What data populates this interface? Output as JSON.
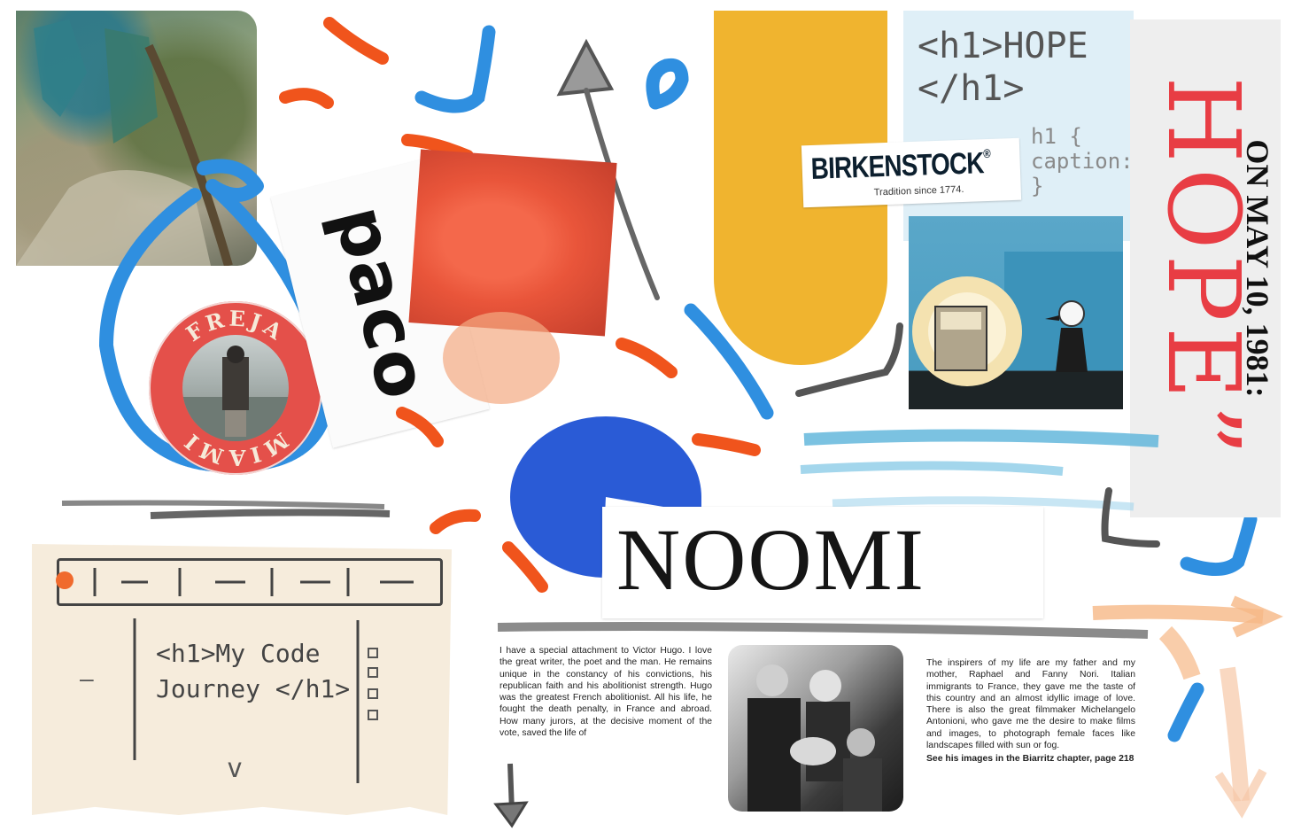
{
  "collage": {
    "paco": "paco",
    "freja_top": "FREJA",
    "freja_bottom": "MIAMI",
    "birkenstock": "BIRKENSTOCK",
    "birkenstock_reg": "®",
    "birkenstock_tagline": "Tradition since 1774.",
    "h1_hope_line1": "<h1>HOPE",
    "h1_hope_line2": "</h1>",
    "h1_caption_line1": "h1 {",
    "h1_caption_line2": "caption:",
    "h1_caption_line3": "}",
    "hope_big": "HOPE",
    "hope_quote": "”",
    "hope_date": "ON MAY 10, 1981:",
    "noomi": "NOOMI",
    "sketch_code_line1": "<h1>My Code",
    "sketch_code_line2": "Journey </h1>",
    "sketch_dash": "—",
    "sketch_chevron": "v",
    "article_hugo": "I have a special attachment to Victor Hugo. I love the great writer, the poet and the man. He remains unique in the constancy of his convictions, his republican faith and his abolitionist strength. Hugo was the greatest French abolitionist. All his life, he fought the death penalty, in France and abroad. How many jurors, at the decisive moment of the vote, saved the life of",
    "article_inspirers": "The inspirers of my life are my father and my mother, Raphael and Fanny Nori. Italian immigrants to France, they gave me the taste of this country and an almost idyllic image of love. There is also the great filmmaker Michelangelo Antonioni, who gave me the desire to make films and images, to photograph female faces like landscapes filled with sun or fog.",
    "article_see": "See his images in the Biarritz chapter, page 218"
  },
  "colors": {
    "pipe_blue": "#2f8fe0",
    "pipe_orange": "#f0541c",
    "yellow": "#f0b42f",
    "hope_red": "#e83d44",
    "disc_blue": "#2a5bd6"
  }
}
